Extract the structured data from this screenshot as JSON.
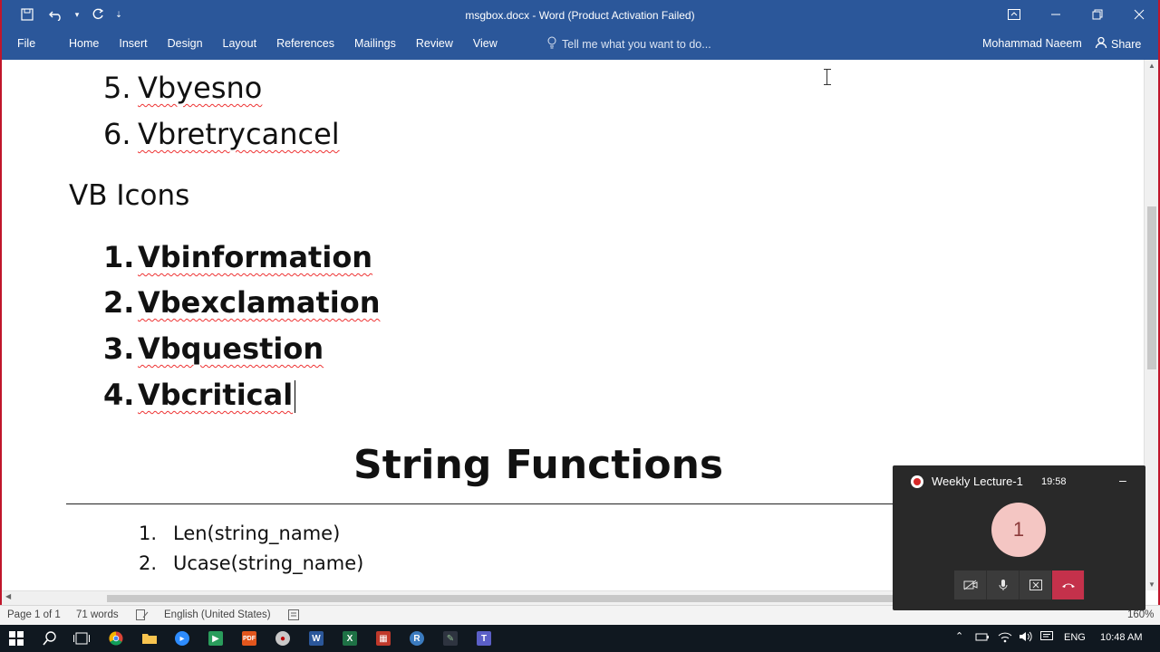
{
  "window": {
    "title": "msgbox.docx - Word (Product Activation Failed)",
    "controls": [
      "ribbon-display",
      "minimize",
      "restore",
      "close"
    ]
  },
  "quick_access": [
    "save-icon",
    "undo-icon",
    "redo-icon",
    "customize-icon"
  ],
  "ribbon": {
    "file": "File",
    "tabs": [
      "Home",
      "Insert",
      "Design",
      "Layout",
      "References",
      "Mailings",
      "Review",
      "View"
    ],
    "tell_me": "Tell me what you want to do...",
    "user": "Mohammad Naeem",
    "share": "Share"
  },
  "document": {
    "list_top": [
      {
        "num": "5.",
        "text": "Vbyesno"
      },
      {
        "num": "6.",
        "text": "Vbretrycancel"
      }
    ],
    "icons_heading": "VB Icons",
    "icons_list": [
      {
        "num": "1.",
        "text": "Vbinformation"
      },
      {
        "num": "2.",
        "text": "Vbexclamation"
      },
      {
        "num": "3.",
        "text": "Vbquestion"
      },
      {
        "num": "4.",
        "text": "Vbcritical"
      }
    ],
    "section_heading": "String Functions",
    "string_list": [
      {
        "num": "1.",
        "text": "Len(string_name)"
      },
      {
        "num": "2.",
        "text": "Ucase(string_name)"
      }
    ]
  },
  "status": {
    "page": "Page 1 of 1",
    "words": "71 words",
    "language": "English (United States)",
    "zoom": "160%"
  },
  "meeting": {
    "title": "Weekly Lecture-1",
    "time": "19:58",
    "participant": "1"
  },
  "taskbar": {
    "lang": "ENG",
    "time": "10:48 AM"
  },
  "colors": {
    "word_blue": "#2b579a",
    "end_call": "#c4314b",
    "avatar_bg": "#f4c6c3"
  }
}
